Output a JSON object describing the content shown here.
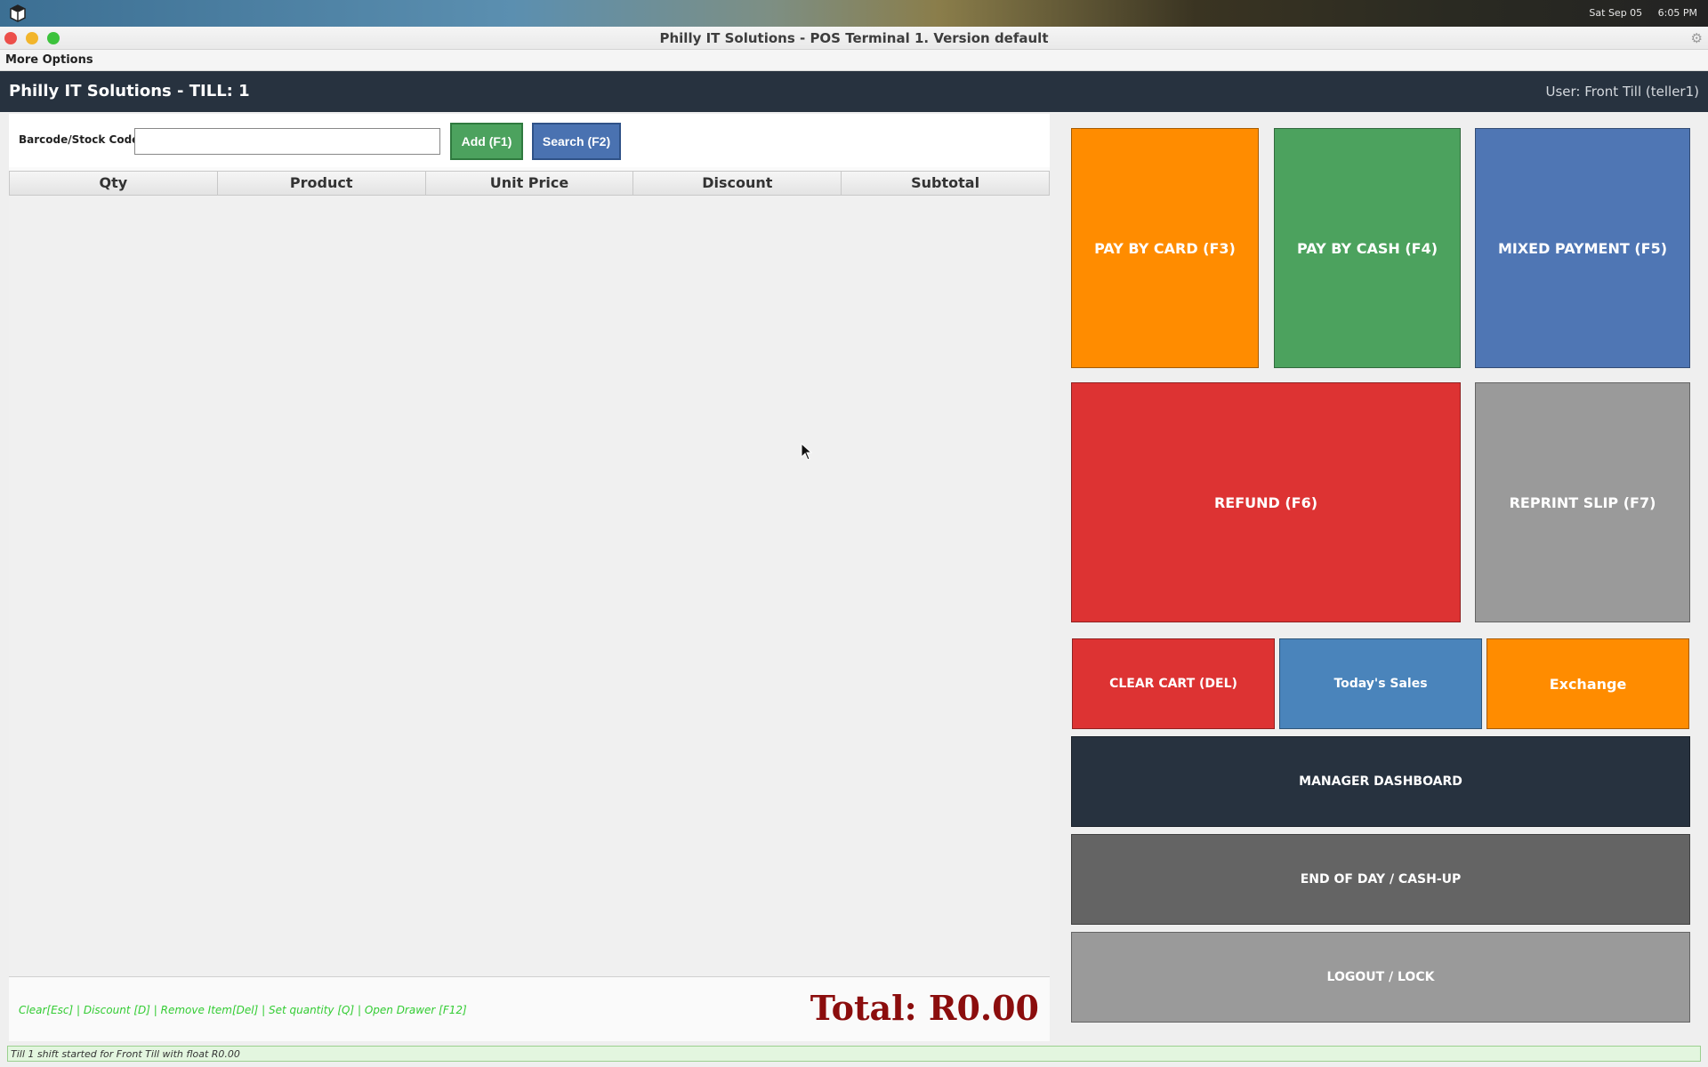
{
  "desktop": {
    "date": "Sat Sep 05",
    "time": "6:05 PM"
  },
  "window": {
    "title": "Philly IT Solutions - POS Terminal 1. Version default"
  },
  "menu": {
    "more_options": "More Options"
  },
  "header": {
    "title": "Philly IT Solutions - TILL: 1",
    "user": "User: Front Till (teller1)"
  },
  "scan": {
    "label": "Barcode/Stock Code:",
    "value": "",
    "add_label": "Add (F1)",
    "search_label": "Search (F2)"
  },
  "cart": {
    "columns": [
      "Qty",
      "Product",
      "Unit Price",
      "Discount",
      "Subtotal"
    ],
    "rows": []
  },
  "footer": {
    "shortcuts": "Clear[Esc] | Discount [D] | Remove Item[Del] | Set quantity [Q] | Open Drawer [F12]",
    "total": "Total: R0.00"
  },
  "actions": {
    "pay_card": "PAY BY CARD (F3)",
    "pay_cash": "PAY BY CASH (F4)",
    "mixed_payment": "MIXED PAYMENT (F5)",
    "refund": "REFUND (F6)",
    "reprint_slip": "REPRINT SLIP (F7)",
    "clear_cart": "CLEAR CART (DEL)",
    "todays_sales": "Today's Sales",
    "exchange": "Exchange",
    "manager_dashboard": "MANAGER DASHBOARD",
    "end_of_day": "END OF DAY / CASH-UP",
    "logout": "LOGOUT / LOCK"
  },
  "colors": {
    "orange": "#ff8c00",
    "green": "#4ca25e",
    "blue": "#4f76b4",
    "red": "#dd3333",
    "gray": "#9a9a9a",
    "steel_blue": "#4a84bb",
    "dark_navy": "#27323f",
    "dark_gray": "#646464",
    "total_red": "#8b0d0d"
  },
  "status": {
    "message": "Till 1 shift started for Front Till with float R0.00"
  }
}
